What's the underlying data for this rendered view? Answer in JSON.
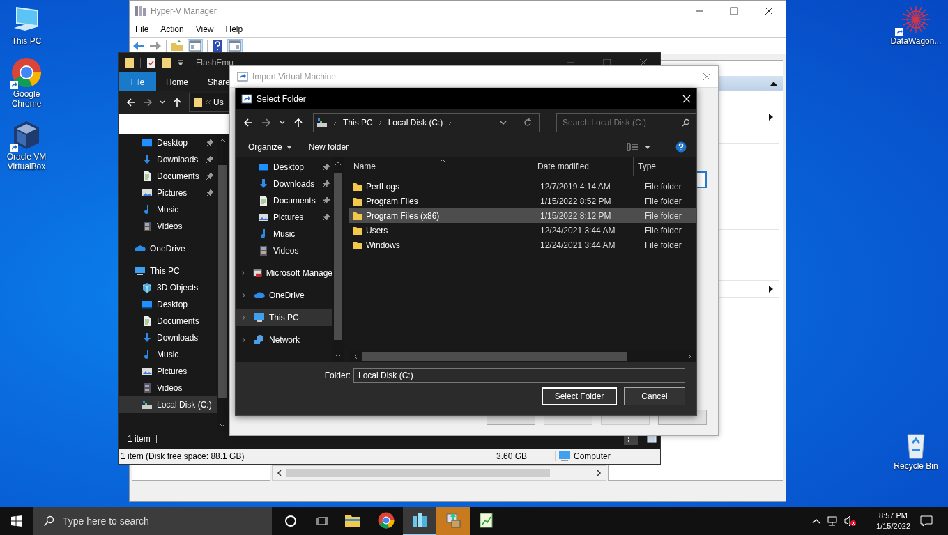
{
  "desktop_icons_left": [
    {
      "label": "This PC",
      "kind": "pc",
      "shortcut": false
    },
    {
      "label": "Google Chrome",
      "kind": "chrome",
      "shortcut": true
    },
    {
      "label": "Oracle VM VirtualBox",
      "kind": "virtualbox",
      "shortcut": true
    }
  ],
  "desktop_icons_right": [
    {
      "label": "DataWagon...",
      "kind": "datawagon",
      "shortcut": true
    },
    {
      "label": "Recycle Bin",
      "kind": "recycle",
      "shortcut": false
    }
  ],
  "hyperv": {
    "title": "Hyper-V Manager",
    "menu": [
      "File",
      "Action",
      "View",
      "Help"
    ]
  },
  "explorer": {
    "title": "FlashEmu",
    "ribbon_tabs": [
      {
        "label": "File",
        "selected": true
      },
      {
        "label": "Home",
        "selected": false
      },
      {
        "label": "Share",
        "selected": false
      }
    ],
    "address": "Us",
    "quick_access": [
      {
        "label": "Desktop",
        "kind": "desktop",
        "pinned": true
      },
      {
        "label": "Downloads",
        "kind": "downloads",
        "pinned": true
      },
      {
        "label": "Documents",
        "kind": "documents",
        "pinned": true
      },
      {
        "label": "Pictures",
        "kind": "pictures",
        "pinned": true
      },
      {
        "label": "Music",
        "kind": "music",
        "pinned": false
      },
      {
        "label": "Videos",
        "kind": "videos",
        "pinned": false
      }
    ],
    "tree": [
      {
        "label": "OneDrive",
        "kind": "onedrive",
        "selected": false
      },
      {
        "label": "This PC",
        "kind": "pc",
        "selected": false,
        "children": [
          {
            "label": "3D Objects",
            "kind": "objects3d",
            "selected": false
          },
          {
            "label": "Desktop",
            "kind": "desktop",
            "selected": false
          },
          {
            "label": "Documents",
            "kind": "documents",
            "selected": false
          },
          {
            "label": "Downloads",
            "kind": "downloads",
            "selected": false
          },
          {
            "label": "Music",
            "kind": "music",
            "selected": false
          },
          {
            "label": "Pictures",
            "kind": "pictures",
            "selected": false
          },
          {
            "label": "Videos",
            "kind": "videos",
            "selected": false
          },
          {
            "label": "Local Disk (C:)",
            "kind": "disk",
            "selected": true
          }
        ]
      }
    ],
    "status": "1 item",
    "details_bar": {
      "summary": "1 item (Disk free space: 88.1 GB)",
      "size": "3.60 GB",
      "location": "Computer"
    }
  },
  "import_vm": {
    "title": "Import Virtual Machine",
    "buttons": [
      {
        "disabled": false
      },
      {
        "disabled": true
      },
      {
        "disabled": true
      },
      {
        "disabled": false
      }
    ]
  },
  "select_folder": {
    "title": "Select Folder",
    "breadcrumb": [
      "This PC",
      "Local Disk (C:)"
    ],
    "search": {
      "placeholder": "Search Local Disk (C:)"
    },
    "commands": [
      "Organize",
      "New folder"
    ],
    "quick_access": [
      {
        "label": "Desktop",
        "kind": "desktop",
        "pinned": true
      },
      {
        "label": "Downloads",
        "kind": "downloads",
        "pinned": true
      },
      {
        "label": "Documents",
        "kind": "documents",
        "pinned": true
      },
      {
        "label": "Pictures",
        "kind": "pictures",
        "pinned": true
      },
      {
        "label": "Music",
        "kind": "music",
        "pinned": false
      },
      {
        "label": "Videos",
        "kind": "videos",
        "pinned": false
      }
    ],
    "tree": [
      {
        "label": "Microsoft Manage",
        "kind": "mmc",
        "selected": false,
        "expanded": false
      },
      {
        "label": "OneDrive",
        "kind": "onedrive",
        "selected": false,
        "expanded": false
      },
      {
        "label": "This PC",
        "kind": "pc",
        "selected": true,
        "expanded": false
      },
      {
        "label": "Network",
        "kind": "network",
        "selected": false,
        "expanded": false
      }
    ],
    "columns": [
      "Name",
      "Date modified",
      "Type"
    ],
    "files": [
      {
        "name": "PerfLogs",
        "date": "12/7/2019 4:14 AM",
        "type": "File folder",
        "selected": false
      },
      {
        "name": "Program Files",
        "date": "1/15/2022 8:52 PM",
        "type": "File folder",
        "selected": false
      },
      {
        "name": "Program Files (x86)",
        "date": "1/15/2022 8:12 PM",
        "type": "File folder",
        "selected": true
      },
      {
        "name": "Users",
        "date": "12/24/2021 3:44 AM",
        "type": "File folder",
        "selected": false
      },
      {
        "name": "Windows",
        "date": "12/24/2021 3:44 AM",
        "type": "File folder",
        "selected": false
      }
    ],
    "folder_label": "Folder:",
    "folder_value": "Local Disk (C:)",
    "buttons": [
      "Select Folder",
      "Cancel"
    ]
  },
  "taskbar": {
    "search_placeholder": "Type here to search",
    "apps": [
      {
        "kind": "explorer",
        "active": false,
        "flashing": false
      },
      {
        "kind": "chrome",
        "active": false,
        "flashing": false
      },
      {
        "kind": "hyperv",
        "active": true,
        "flashing": false
      },
      {
        "kind": "installer",
        "active": false,
        "flashing": true
      },
      {
        "kind": "editor",
        "active": false,
        "flashing": false
      }
    ],
    "time": "8:57 PM",
    "date": "1/15/2022"
  }
}
